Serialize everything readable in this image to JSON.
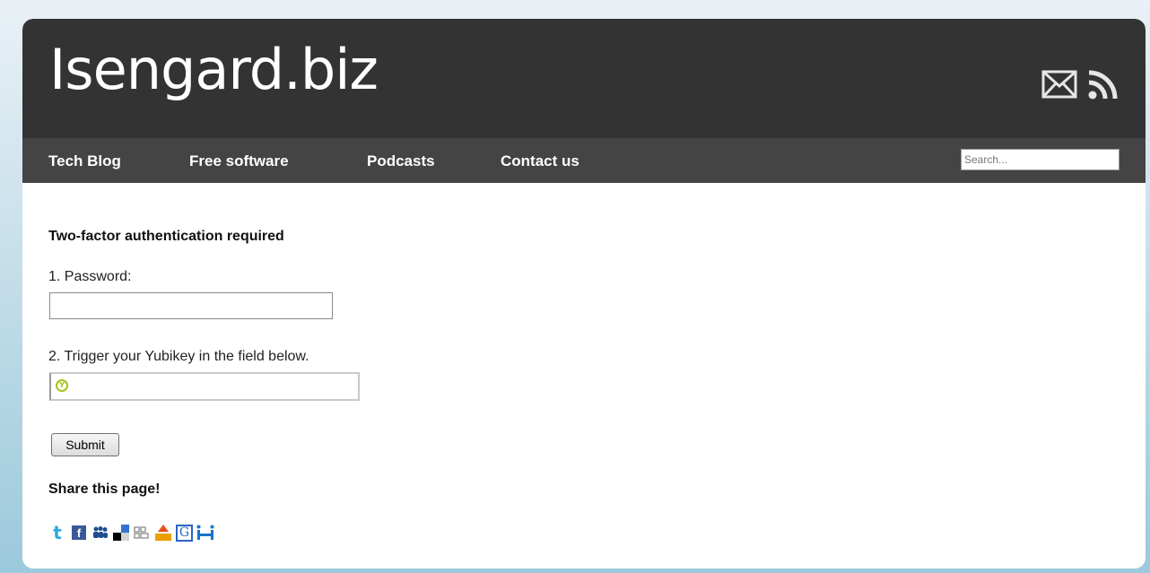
{
  "header": {
    "site_title": "Isengard.biz",
    "icons": [
      "mail-icon",
      "rss-icon"
    ]
  },
  "nav": {
    "items": [
      {
        "label": "Tech Blog"
      },
      {
        "label": "Free software"
      },
      {
        "label": "Podcasts"
      },
      {
        "label": "Contact us"
      }
    ],
    "search_placeholder": "Search..."
  },
  "form": {
    "title": "Two-factor authentication required",
    "password_label": "1. Password:",
    "password_value": "",
    "yubikey_label": "2. Trigger your Yubikey in the field below.",
    "yubikey_value": "",
    "yubikey_icon_glyph": "Y",
    "submit_label": "Submit"
  },
  "share": {
    "title": "Share this page!",
    "icons": [
      "twitter-icon",
      "facebook-icon",
      "myspace-icon",
      "delicious-icon",
      "digg-icon",
      "stumbleupon-icon",
      "google-bookmarks-icon",
      "hi5-icon"
    ]
  },
  "colors": {
    "header_bg": "#333333",
    "nav_bg": "#444444",
    "yubikey_green": "#a6c21a"
  }
}
